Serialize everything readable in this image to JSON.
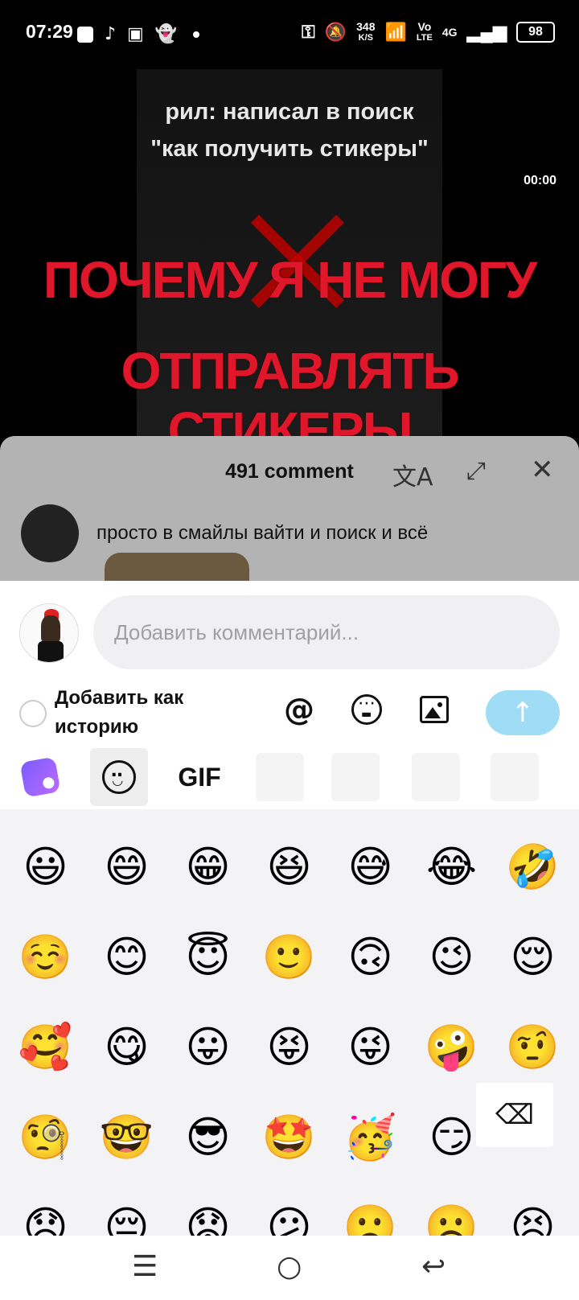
{
  "status_bar": {
    "time": "07:29",
    "speed_value": "348",
    "speed_unit": "K/S",
    "volte_top": "Vo",
    "volte_bottom": "LTE",
    "network": "4G",
    "battery": "98",
    "icons": [
      "notification-icon",
      "tiktok-icon",
      "app-icon",
      "snapchat-icon",
      "dot-icon",
      "key-icon",
      "silent-icon",
      "wifi-icon",
      "signal-icon"
    ]
  },
  "video": {
    "caption_line1": "рил: написал в поиск",
    "caption_line2": "\"как получить стикеры\"",
    "time": "00:00",
    "title_line1": "ПОЧЕМУ Я НЕ МОГУ",
    "title_line2": "ОТПРАВЛЯТЬ СТИКЕРЫ",
    "title_color": "#e0172b"
  },
  "comments": {
    "count": "491 comment",
    "translate_icon": "translate-icon",
    "expand_icon": "expand-icon",
    "close_icon": "close-icon",
    "first_comment": "просто в смайлы вайти и поиск и всё"
  },
  "composer": {
    "placeholder": "Добавить комментарий...",
    "story_label": "Добавить как историю",
    "mention_symbol": "@",
    "send_color": "#9fdcf6",
    "tabs": {
      "gif": "GIF"
    }
  },
  "emoji_grid": [
    [
      "😃",
      "😄",
      "😁",
      "😆",
      "😅",
      "😂",
      "🤣"
    ],
    [
      "☺️",
      "😊",
      "😇",
      "🙂",
      "🙃",
      "😉",
      "😌"
    ],
    [
      "🥰",
      "😋",
      "😛",
      "😝",
      "😜",
      "🤪",
      "🤨"
    ],
    [
      "🧐",
      "🤓",
      "😎",
      "🤩",
      "🥳",
      "😏",
      ""
    ],
    [
      "😞",
      "😔",
      "😟",
      "😕",
      "🙁",
      "☹️",
      "😣"
    ]
  ],
  "keyboard": {
    "backspace_icon": "backspace-icon"
  },
  "nav_bar": {
    "menu_icon": "menu-icon",
    "home_icon": "home-icon",
    "back_icon": "back-icon"
  }
}
